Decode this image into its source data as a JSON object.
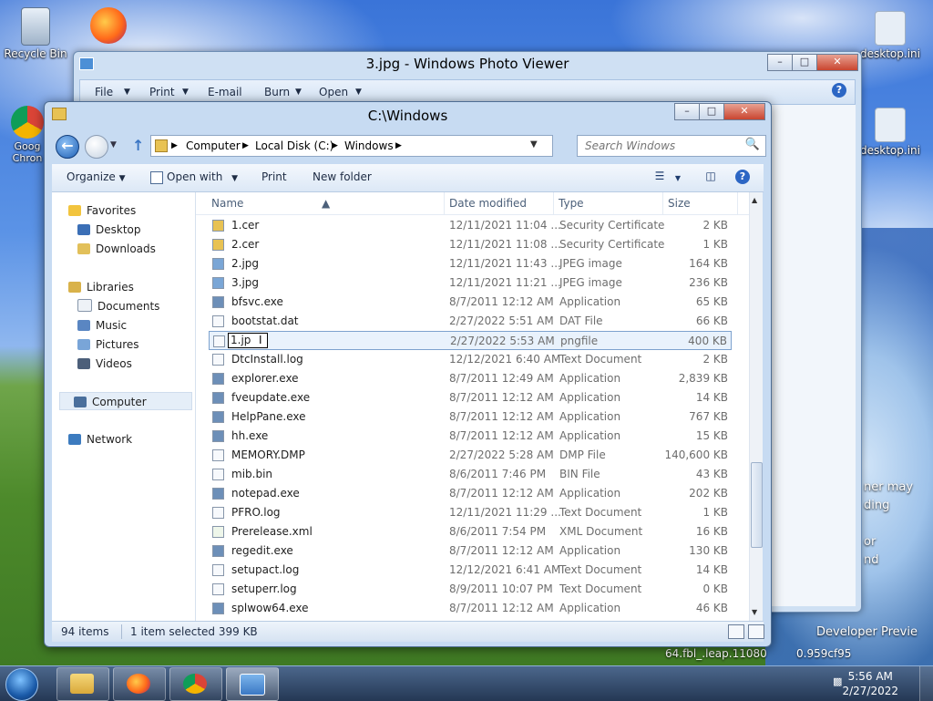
{
  "desktop": {
    "icons": [
      {
        "label": "Recycle Bin"
      },
      {
        "label": ""
      },
      {
        "label": "Goog Chron"
      },
      {
        "label": "desktop.ini"
      },
      {
        "label": "desktop.ini"
      }
    ],
    "background_text": [
      "Developer Previe",
      "64.fbl_.leap.11080",
      "0.959cf95",
      "ner may",
      "ding",
      "or",
      "nd"
    ]
  },
  "photo_viewer": {
    "title": "3.jpg - Windows Photo Viewer",
    "menu": [
      "File",
      "Print",
      "E-mail",
      "Burn",
      "Open"
    ],
    "help_glyph": "?"
  },
  "explorer": {
    "title": "C:\\Windows",
    "breadcrumb": [
      "Computer",
      "Local Disk (C:)",
      "Windows"
    ],
    "search_placeholder": "Search Windows",
    "toolbar": {
      "organize": "Organize",
      "open_with": "Open with",
      "print": "Print",
      "new_folder": "New folder"
    },
    "nav": {
      "favorites": "Favorites",
      "desktop": "Desktop",
      "downloads": "Downloads",
      "libraries": "Libraries",
      "documents": "Documents",
      "music": "Music",
      "pictures": "Pictures",
      "videos": "Videos",
      "computer": "Computer",
      "network": "Network"
    },
    "columns": {
      "name": "Name",
      "date": "Date modified",
      "type": "Type",
      "size": "Size"
    },
    "files": [
      {
        "name": "1.cer",
        "date": "12/11/2021 11:04 ...",
        "type": "Security Certificate",
        "size": "2 KB"
      },
      {
        "name": "2.cer",
        "date": "12/11/2021 11:08 ...",
        "type": "Security Certificate",
        "size": "1 KB"
      },
      {
        "name": "2.jpg",
        "date": "12/11/2021 11:43 ...",
        "type": "JPEG image",
        "size": "164 KB"
      },
      {
        "name": "3.jpg",
        "date": "12/11/2021 11:21 ...",
        "type": "JPEG image",
        "size": "236 KB"
      },
      {
        "name": "bfsvc.exe",
        "date": "8/7/2011 12:12 AM",
        "type": "Application",
        "size": "65 KB"
      },
      {
        "name": "bootstat.dat",
        "date": "2/27/2022 5:51 AM",
        "type": "DAT File",
        "size": "66 KB"
      },
      {
        "name": "1.jp",
        "date": "2/27/2022 5:53 AM",
        "type": "pngfile",
        "size": "400 KB"
      },
      {
        "name": "DtcInstall.log",
        "date": "12/12/2021 6:40 AM",
        "type": "Text Document",
        "size": "2 KB"
      },
      {
        "name": "explorer.exe",
        "date": "8/7/2011 12:49 AM",
        "type": "Application",
        "size": "2,839 KB"
      },
      {
        "name": "fveupdate.exe",
        "date": "8/7/2011 12:12 AM",
        "type": "Application",
        "size": "14 KB"
      },
      {
        "name": "HelpPane.exe",
        "date": "8/7/2011 12:12 AM",
        "type": "Application",
        "size": "767 KB"
      },
      {
        "name": "hh.exe",
        "date": "8/7/2011 12:12 AM",
        "type": "Application",
        "size": "15 KB"
      },
      {
        "name": "MEMORY.DMP",
        "date": "2/27/2022 5:28 AM",
        "type": "DMP File",
        "size": "140,600 KB"
      },
      {
        "name": "mib.bin",
        "date": "8/6/2011 7:46 PM",
        "type": "BIN File",
        "size": "43 KB"
      },
      {
        "name": "notepad.exe",
        "date": "8/7/2011 12:12 AM",
        "type": "Application",
        "size": "202 KB"
      },
      {
        "name": "PFRO.log",
        "date": "12/11/2021 11:29 ...",
        "type": "Text Document",
        "size": "1 KB"
      },
      {
        "name": "Prerelease.xml",
        "date": "8/6/2011 7:54 PM",
        "type": "XML Document",
        "size": "16 KB"
      },
      {
        "name": "regedit.exe",
        "date": "8/7/2011 12:12 AM",
        "type": "Application",
        "size": "130 KB"
      },
      {
        "name": "setupact.log",
        "date": "12/12/2021 6:41 AM",
        "type": "Text Document",
        "size": "14 KB"
      },
      {
        "name": "setuperr.log",
        "date": "8/9/2011 10:07 PM",
        "type": "Text Document",
        "size": "0 KB"
      },
      {
        "name": "splwow64.exe",
        "date": "8/7/2011 12:12 AM",
        "type": "Application",
        "size": "46 KB"
      }
    ],
    "status": {
      "count": "94 items",
      "selection": "1 item selected  399 KB"
    }
  },
  "taskbar": {
    "time": "5:56 AM",
    "date": "2/27/2022"
  },
  "colors": {
    "accent": "#3a75c4",
    "selection": "#e9f2fc"
  }
}
